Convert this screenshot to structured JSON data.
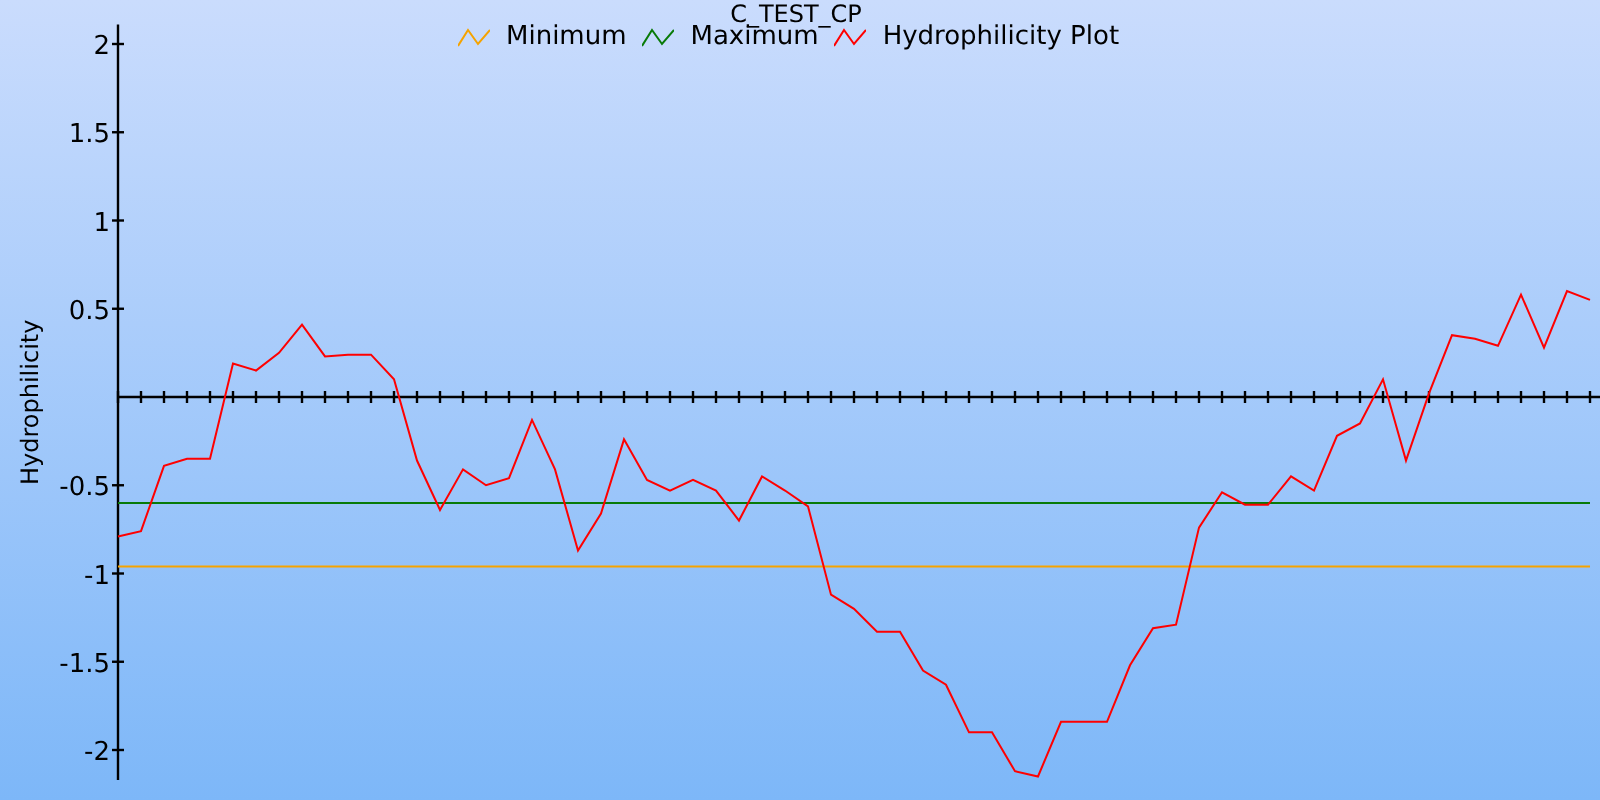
{
  "chart": {
    "chart_data": {
      "type": "line",
      "legend": "top",
      "title": "C_TEST_CP",
      "ylabel": "Hydrophilicity",
      "ylim": [
        -2.17,
        2.11
      ],
      "yticks": [
        {
          "value": -2,
          "label": "-2"
        },
        {
          "value": -1.5,
          "label": "-1.5"
        },
        {
          "value": -1,
          "label": "-1"
        },
        {
          "value": -0.5,
          "label": "-0.5"
        },
        {
          "value": 0.5,
          "label": "0.5"
        },
        {
          "value": 1,
          "label": "1"
        },
        {
          "value": 1.5,
          "label": "1.5"
        },
        {
          "value": 2,
          "label": "2"
        }
      ],
      "series": [
        {
          "name": "Minimum",
          "color": "#f5a300",
          "values": [
            -0.96,
            -0.96,
            -0.96,
            -0.96,
            -0.96,
            -0.96,
            -0.96,
            -0.96,
            -0.96,
            -0.96,
            -0.96,
            -0.96,
            -0.96,
            -0.96,
            -0.96,
            -0.96,
            -0.96,
            -0.96,
            -0.96,
            -0.96,
            -0.96,
            -0.96,
            -0.96,
            -0.96,
            -0.96,
            -0.96,
            -0.96,
            -0.96,
            -0.96,
            -0.96,
            -0.96,
            -0.96,
            -0.96,
            -0.96,
            -0.96,
            -0.96,
            -0.96,
            -0.96,
            -0.96,
            -0.96,
            -0.96,
            -0.96,
            -0.96,
            -0.96,
            -0.96,
            -0.96,
            -0.96,
            -0.96,
            -0.96,
            -0.96,
            -0.96,
            -0.96,
            -0.96,
            -0.96,
            -0.96,
            -0.96,
            -0.96,
            -0.96,
            -0.96,
            -0.96,
            -0.96,
            -0.96,
            -0.96,
            -0.96,
            -0.96
          ]
        },
        {
          "name": "Maximum",
          "color": "#087a08",
          "values": [
            -0.6,
            -0.6,
            -0.6,
            -0.6,
            -0.6,
            -0.6,
            -0.6,
            -0.6,
            -0.6,
            -0.6,
            -0.6,
            -0.6,
            -0.6,
            -0.6,
            -0.6,
            -0.6,
            -0.6,
            -0.6,
            -0.6,
            -0.6,
            -0.6,
            -0.6,
            -0.6,
            -0.6,
            -0.6,
            -0.6,
            -0.6,
            -0.6,
            -0.6,
            -0.6,
            -0.6,
            -0.6,
            -0.6,
            -0.6,
            -0.6,
            -0.6,
            -0.6,
            -0.6,
            -0.6,
            -0.6,
            -0.6,
            -0.6,
            -0.6,
            -0.6,
            -0.6,
            -0.6,
            -0.6,
            -0.6,
            -0.6,
            -0.6,
            -0.6,
            -0.6,
            -0.6,
            -0.6,
            -0.6,
            -0.6,
            -0.6,
            -0.6,
            -0.6,
            -0.6,
            -0.6,
            -0.6,
            -0.6,
            -0.6,
            -0.6
          ]
        },
        {
          "name": "Hydrophilicity Plot",
          "color": "#ff0000",
          "values": [
            -0.79,
            -0.76,
            -0.39,
            -0.35,
            -0.35,
            0.19,
            0.15,
            0.25,
            0.41,
            0.23,
            0.24,
            0.24,
            0.1,
            -0.36,
            -0.64,
            -0.41,
            -0.5,
            -0.46,
            -0.13,
            -0.41,
            -0.87,
            -0.66,
            -0.24,
            -0.47,
            -0.53,
            -0.47,
            -0.53,
            -0.7,
            -0.45,
            -0.53,
            -0.62,
            -1.12,
            -1.2,
            -1.33,
            -1.33,
            -1.55,
            -1.63,
            -1.9,
            -1.9,
            -2.12,
            -2.15,
            -1.84,
            -1.84,
            -1.84,
            -1.52,
            -1.31,
            -1.29,
            -0.74,
            -0.54,
            -0.61,
            -0.61,
            -0.45,
            -0.53,
            -0.22,
            -0.15,
            0.1,
            -0.36,
            0.02,
            0.35,
            0.33,
            0.29,
            0.58,
            0.28,
            0.6,
            0.55
          ]
        }
      ]
    }
  }
}
